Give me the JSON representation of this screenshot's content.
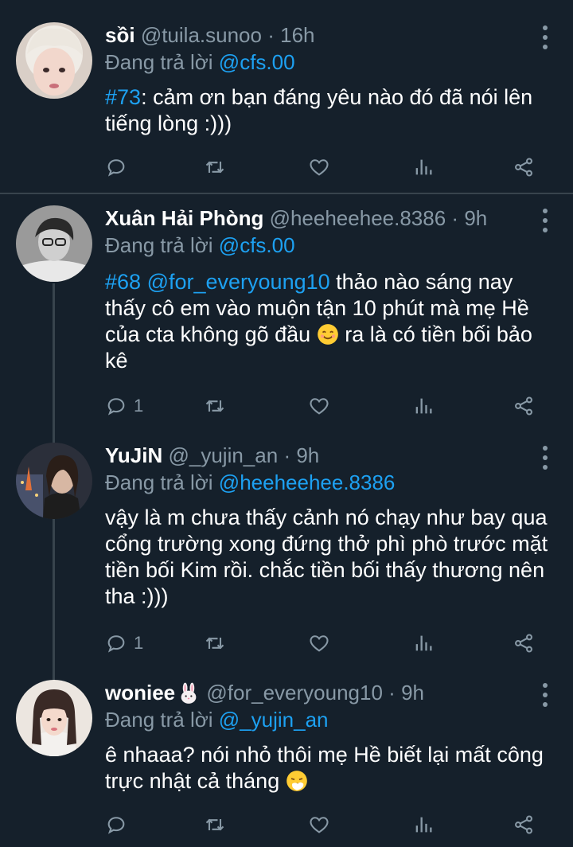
{
  "tweets": [
    {
      "name": "sồi",
      "handle": "@tuila.sunoo",
      "time": "16h",
      "reply_prefix": "Đang trả lời",
      "reply_to": "@cfs.00",
      "body_tag": "#73",
      "body_text": ": cảm ơn bạn đáng yêu nào đó đã nói lên tiếng lòng :)))",
      "reply_count": ""
    },
    {
      "name": "Xuân Hải Phòng",
      "handle": "@heeheehee.8386",
      "time": "9h",
      "reply_prefix": "Đang trả lời",
      "reply_to": "@cfs.00",
      "body_tag": "#68",
      "body_mention": "@for_everyoung10",
      "body_text_1": " thảo nào sáng nay thấy cô em vào muộn tận 10 phút mà mẹ Hề của cta không gõ đầu ",
      "body_text_2": " ra là có tiền bối bảo kê",
      "reply_count": "1"
    },
    {
      "name": "YuJiN",
      "handle": "@_yujin_an",
      "time": "9h",
      "reply_prefix": "Đang trả lời",
      "reply_to": "@heeheehee.8386",
      "body_text": "vậy là m chưa thấy cảnh nó chạy như bay qua cổng trường xong đứng thở phì phò trước mặt tiền bối Kim rồi. chắc tiền bối thấy thương nên tha :)))",
      "reply_count": "1"
    },
    {
      "name": "woniee",
      "handle": "@for_everyoung10",
      "time": "9h",
      "reply_prefix": "Đang trả lời",
      "reply_to": "@_yujin_an",
      "body_text": "ê nhaaa? nói nhỏ thôi mẹ Hề biết lại mất công trực nhật cả tháng ",
      "reply_count": ""
    }
  ],
  "separator": "·",
  "icons": {
    "reply": "reply-icon",
    "retweet": "retweet-icon",
    "like": "heart-icon",
    "stats": "analytics-icon",
    "share": "share-icon",
    "more": "more-vertical-icon"
  },
  "colors": {
    "background": "#15202b",
    "muted": "#8899a6",
    "link": "#1da1f2",
    "divider": "#38444d"
  }
}
